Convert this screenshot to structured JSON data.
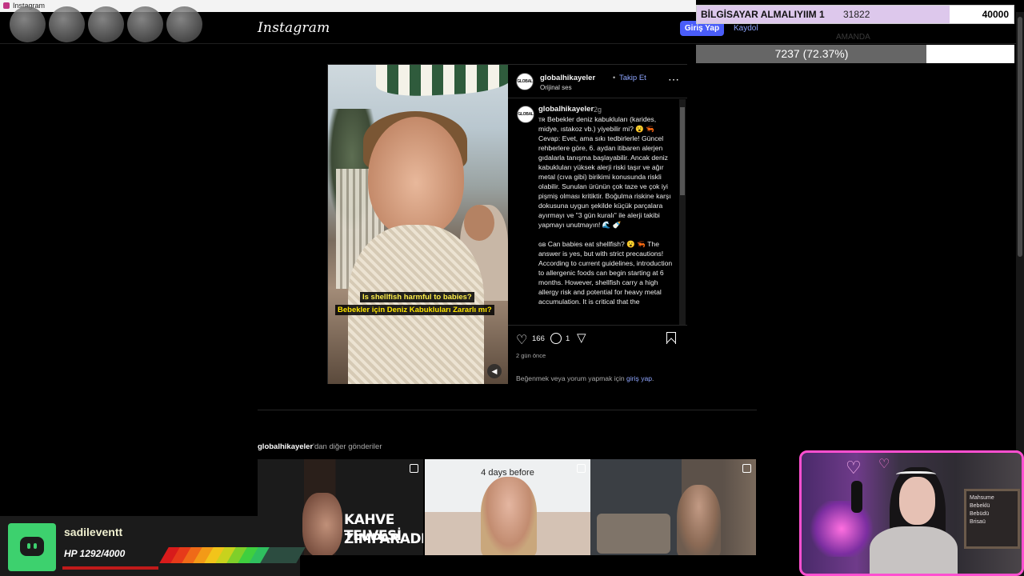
{
  "window": {
    "title": "Instagram"
  },
  "header": {
    "logo": "Instagram",
    "login_button": "Giriş Yap",
    "signup_link": "Kaydol"
  },
  "stream_overlay": {
    "goal": {
      "label": "BİLGİSAYAR ALMALIYIIM 1",
      "current": "31822",
      "target": "40000",
      "fraction": 0.7956
    },
    "progress": {
      "label": "7237 (72.37%)",
      "fraction": 0.7237,
      "ghost_label": "AMANDA"
    },
    "hp": {
      "username": "sadileventt",
      "hp_text": "HP 1292/4000",
      "fraction": 0.323
    },
    "webcam_board_text": [
      "Mahsume",
      "Bebeklü",
      "Bebüdü",
      "Brisaü"
    ]
  },
  "post": {
    "author": "globalhikayeler",
    "follow_separator": "•",
    "follow_label": "Takip Et",
    "audio_label": "Orijinal ses",
    "avatar_text": "GLOBAL",
    "media": {
      "subtitle_en": "Is shellfish harmful to babies?",
      "subtitle_tr": "Bebekler için Deniz Kabukluları Zararlı mı?",
      "sound_icon": "speaker-icon"
    },
    "caption": {
      "user": "globalhikayeler",
      "time": "2g",
      "text": "ᴛʀ Bebekler deniz kabukluları (karides, midye, ıstakoz vb.) yiyebilir mi? 😮 🦐\nCevap: Evet, ama sıkı tedbirlerle! Güncel rehberlere göre, 6. aydan itibaren alerjen gıdalarla tanışma başlayabilir. Ancak deniz kabukluları yüksek alerji riski taşır ve ağır metal (cıva gibi) birikimi konusunda riskli olabilir. Sunulan ürünün çok taze ve çok iyi pişmiş olması kritiktir. Boğulma riskine karşı dokusuna uygun şekilde küçük parçalara ayırmayı ve \"3 gün kuralı\" ile alerji takibi yapmayı unutmayın! 🌊 🍼\n\nɢʙ Can babies eat shellfish? 😮 🦐 The answer is yes, but with strict precautions! According to current guidelines, introduction to allergenic foods can begin starting at 6 months. However, shellfish carry a high allergy risk and potential for heavy metal accumulation. It is critical that the"
    },
    "likes": "166",
    "comments": "1",
    "time_ago": "2 gün önce",
    "login_prompt_prefix": "Beğenmek veya yorum yapmak için",
    "login_prompt_link": "giriş yap",
    "login_prompt_suffix": "."
  },
  "more_posts": {
    "author": "globalhikayeler",
    "label": "'dan diğer gönderiler",
    "thumbs": [
      {
        "line1": "KAHVE TELVESİ",
        "line2": "ZIMPARADIR"
      },
      {
        "caption": "4 days before"
      },
      {
        "caption": ""
      }
    ]
  },
  "colors": {
    "accent": "#4a5df9",
    "link": "#8fa6ff",
    "webcam_border": "#ff4fd0",
    "hp_logo": "#3dd16e"
  }
}
